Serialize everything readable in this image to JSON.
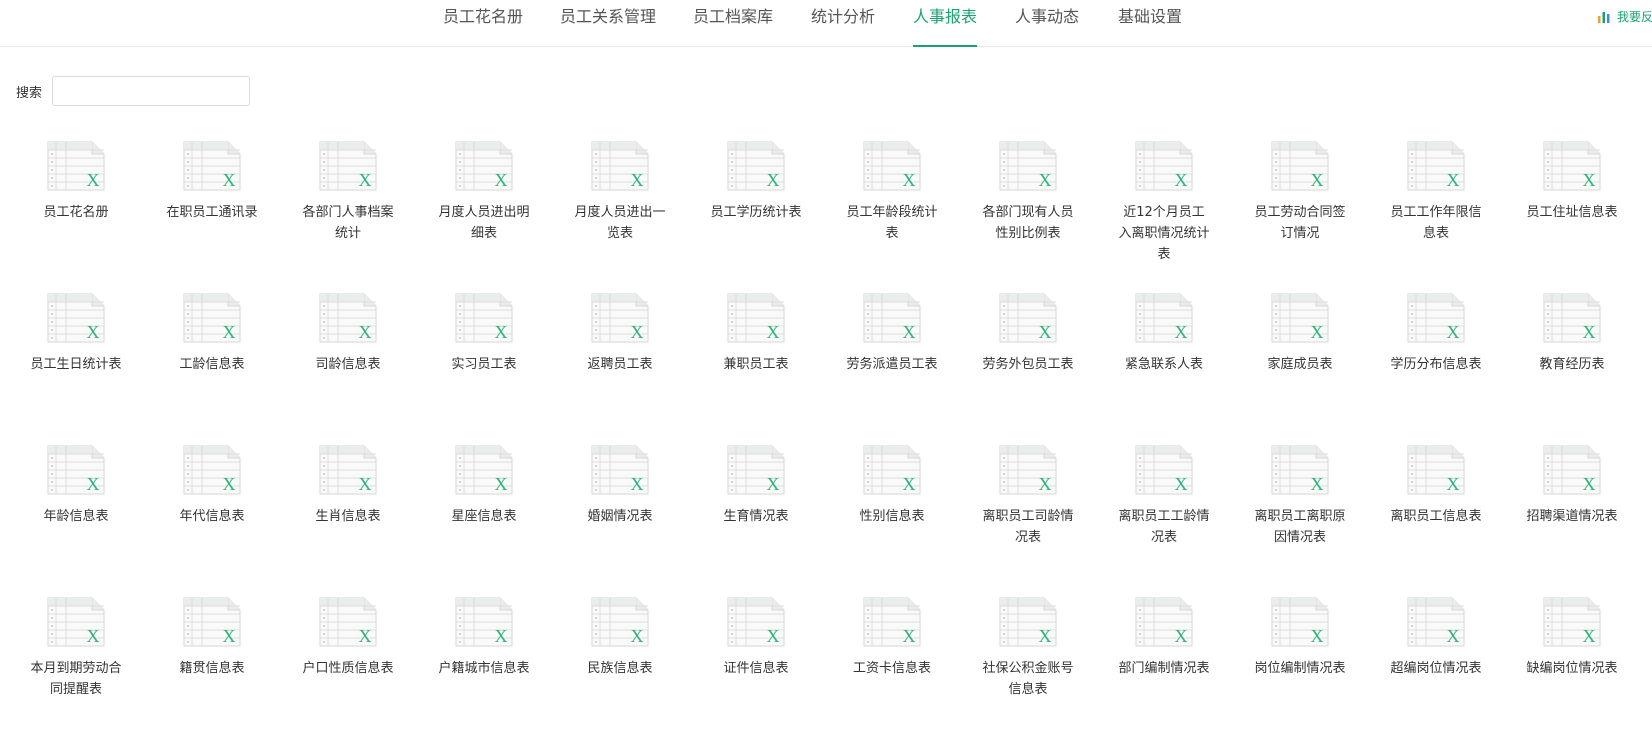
{
  "nav": {
    "tabs": [
      {
        "label": "员工花名册",
        "active": false
      },
      {
        "label": "员工关系管理",
        "active": false
      },
      {
        "label": "员工档案库",
        "active": false
      },
      {
        "label": "统计分析",
        "active": false
      },
      {
        "label": "人事报表",
        "active": true
      },
      {
        "label": "人事动态",
        "active": false
      },
      {
        "label": "基础设置",
        "active": false
      }
    ],
    "feedback_label": "我要反馈",
    "feedback_icon": "bar-chart-icon"
  },
  "search": {
    "label": "搜索",
    "value": "",
    "placeholder": ""
  },
  "reports": [
    "员工花名册",
    "在职员工通讯录",
    "各部门人事档案统计",
    "月度人员进出明细表",
    "月度人员进出一览表",
    "员工学历统计表",
    "员工年龄段统计表",
    "各部门现有人员性别比例表",
    "近12个月员工入离职情况统计表",
    "员工劳动合同签订情况",
    "员工工作年限信息表",
    "员工住址信息表",
    "员工生日统计表",
    "工龄信息表",
    "司龄信息表",
    "实习员工表",
    "返聘员工表",
    "兼职员工表",
    "劳务派遣员工表",
    "劳务外包员工表",
    "紧急联系人表",
    "家庭成员表",
    "学历分布信息表",
    "教育经历表",
    "年龄信息表",
    "年代信息表",
    "生肖信息表",
    "星座信息表",
    "婚姻情况表",
    "生育情况表",
    "性别信息表",
    "离职员工司龄情况表",
    "离职员工工龄情况表",
    "离职员工离职原因情况表",
    "离职员工信息表",
    "招聘渠道情况表",
    "本月到期劳动合同提醒表",
    "籍贯信息表",
    "户口性质信息表",
    "户籍城市信息表",
    "民族信息表",
    "证件信息表",
    "工资卡信息表",
    "社保公积金账号信息表",
    "部门编制情况表",
    "岗位编制情况表",
    "超编岗位情况表",
    "缺编岗位情况表"
  ],
  "report_icon": "excel-file-icon",
  "colors": {
    "accent": "#1aa36f",
    "excel_x": "#2bb673"
  }
}
